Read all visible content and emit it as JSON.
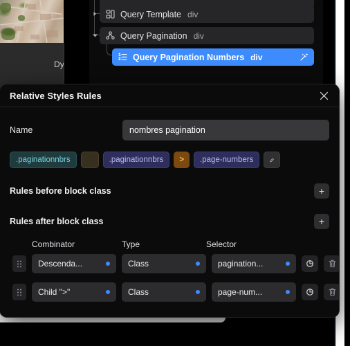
{
  "canvas": {
    "photo_alt": "aerial-photo-thumbnail",
    "sheet_label": "Dy"
  },
  "layer_tree": {
    "rows": [
      {
        "name": "Query Template",
        "tag": "div",
        "icon": "template-icon",
        "caret": "collapsed",
        "selected": false
      },
      {
        "name": "Query Pagination",
        "tag": "div",
        "icon": "pagination-icon",
        "caret": "expanded",
        "selected": false
      },
      {
        "name": "Query Pagination Numbers",
        "tag": "div",
        "icon": "numbered-list-icon",
        "caret": "none",
        "selected": true,
        "trailing_icon": "magic-wand-icon"
      }
    ]
  },
  "modal": {
    "title": "Relative Styles Rules",
    "close_icon": "close-icon",
    "name_field": {
      "label": "Name",
      "value": "nombres pagination",
      "placeholder": "Name"
    },
    "chips": [
      {
        "label": ".paginationnbrs",
        "style": "teal"
      },
      {
        "label": "",
        "style": "blank"
      },
      {
        "label": ".paginationnbrs",
        "style": "indigo"
      },
      {
        "label": ">",
        "style": "amber"
      },
      {
        "label": ".page-numbers",
        "style": "indigo"
      }
    ],
    "chip_edit": {
      "icon": "pencil-icon"
    },
    "sections": [
      {
        "title": "Rules before block class",
        "add_label": "+"
      },
      {
        "title": "Rules after block class",
        "add_label": "+"
      }
    ],
    "rules_table": {
      "columns": [
        "Combinator",
        "Type",
        "Selector"
      ],
      "rows": [
        {
          "drag": "drag-handle-icon",
          "combinator": "Descenda...",
          "type": "Class",
          "selector": "pagination...",
          "duplicate_icon": "duplicate-icon",
          "delete_icon": "trash-icon"
        },
        {
          "drag": "drag-handle-icon",
          "combinator": "Child \">\"",
          "type": "Class",
          "selector": "page-num...",
          "duplicate_icon": "duplicate-icon",
          "delete_icon": "trash-icon"
        }
      ]
    }
  },
  "colors": {
    "accent_blue": "#3d8bfd",
    "chip_teal_text": "#76d3dd",
    "chip_indigo_text": "#b9b9f5",
    "chip_amber_text": "#ffb347",
    "modal_bg": "#0b0b0c",
    "edge_blue": "#4a86d8"
  }
}
